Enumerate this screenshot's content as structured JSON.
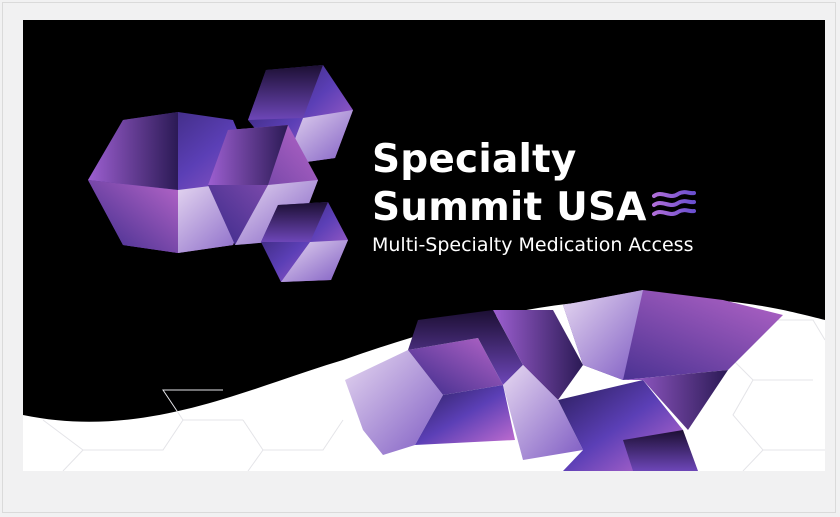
{
  "banner": {
    "title_line_1": "Specialty",
    "title_line_2": "Summit USA",
    "subtitle": "Multi-Specialty Medication Access"
  },
  "colors": {
    "background": "#000000",
    "wave": "#ffffff",
    "frame": "#f1f1f2",
    "accent_purple": "#7b3fb0",
    "accent_violet": "#5d4fc0",
    "accent_pink": "#c86fcf",
    "accent_lavender": "#c8b5e8"
  },
  "icons": [
    "hexagon-cubes-logo-icon",
    "flag-waves-icon"
  ]
}
